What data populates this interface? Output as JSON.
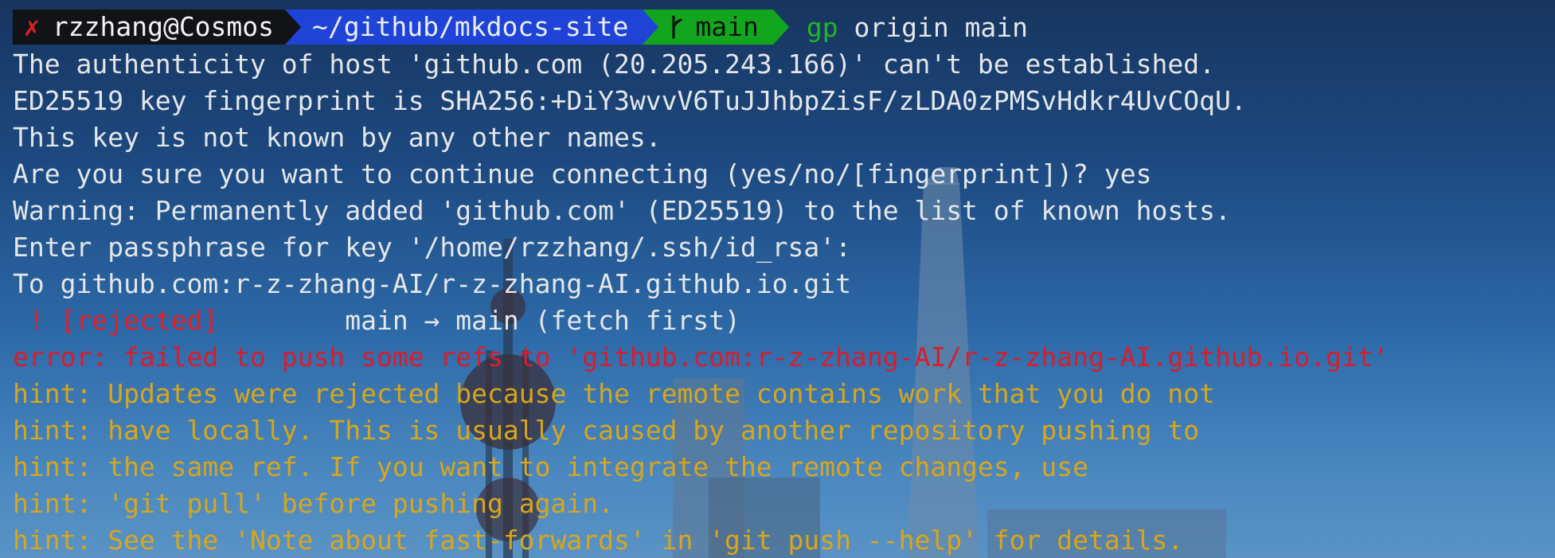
{
  "prompt": {
    "status_icon": "✗",
    "user_host": "rzzhang@Cosmos",
    "path": "~/github/mkdocs-site",
    "branch_icon": "git-branch-icon",
    "branch": "main",
    "command_alias": "gp",
    "command_args": " origin main"
  },
  "output": {
    "line1": "The authenticity of host 'github.com (20.205.243.166)' can't be established.",
    "line2": "ED25519 key fingerprint is SHA256:+DiY3wvvV6TuJJhbpZisF/zLDA0zPMSvHdkr4UvCOqU.",
    "line3": "This key is not known by any other names.",
    "line4": "Are you sure you want to continue connecting (yes/no/[fingerprint])? yes",
    "line5": "Warning: Permanently added 'github.com' (ED25519) to the list of known hosts.",
    "line6": "Enter passphrase for key '/home/rzzhang/.ssh/id_rsa':",
    "line7": "To github.com:r-z-zhang-AI/r-z-zhang-AI.github.io.git",
    "rejected_marker": " ! [rejected]",
    "rejected_detail": "        main → main (fetch first)",
    "error_line": "error: failed to push some refs to 'github.com:r-z-zhang-AI/r-z-zhang-AI.github.io.git'",
    "hints": [
      "hint: Updates were rejected because the remote contains work that you do not",
      "hint: have locally. This is usually caused by another repository pushing to",
      "hint: the same ref. If you want to integrate the remote changes, use",
      "hint: 'git pull' before pushing again.",
      "hint: See the 'Note about fast-forwards' in 'git push --help' for details."
    ]
  },
  "colors": {
    "error_red": "#d81e2c",
    "hint_yellow": "#d7a61c",
    "prompt_green": "#12a61e",
    "prompt_blue": "#1f43d6"
  }
}
